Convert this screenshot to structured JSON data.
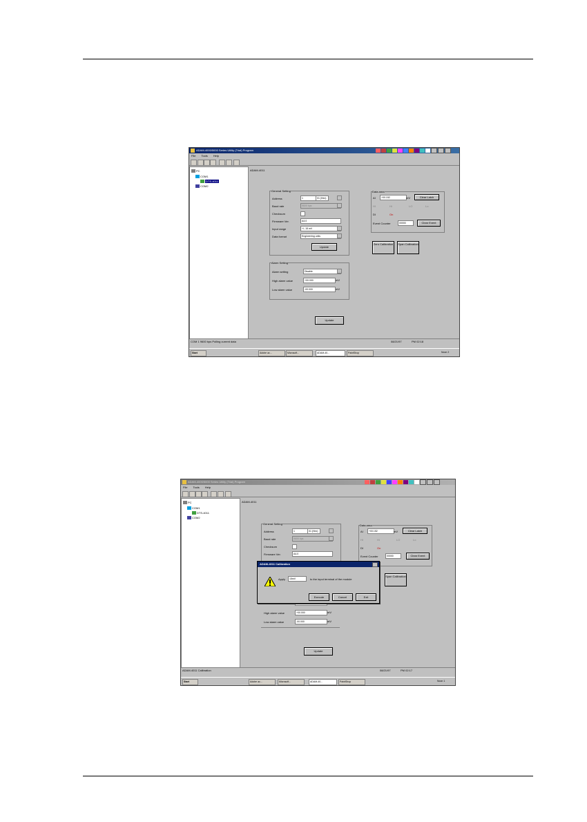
{
  "app_title": "ADAM-4000/5000 Series Utility (Trial) Program",
  "menu": [
    "File",
    "Tools",
    "Help"
  ],
  "tree": {
    "root": "PC",
    "com": "COM1",
    "module": "COM1",
    "device": "DTS-4011",
    "com2": "COM2"
  },
  "module_title": "ADAM-4011",
  "general": {
    "title": "General Setting",
    "address_label": "Address",
    "address_value": "1",
    "address_hex": "01 (Hex)",
    "baud_label": "Baud rate",
    "baud_value": "9600 bps",
    "checksum_label": "Checksum",
    "firmware_label": "Firmware Ver.",
    "firmware_value": "A4.0",
    "input_label": "Input range",
    "input_value": "+/- 15 mV",
    "format_label": "Data format",
    "format_value": "Engineering units",
    "update_label": "Update"
  },
  "data_area": {
    "title": "Data area",
    "ai_label": "AI",
    "ai_value": "+00.152",
    "ai_unit": "mV",
    "clear_latch": "Clear Latch",
    "hi_label": "HI",
    "hi_value": "Hi",
    "lo_label": "LO",
    "lo_value": "Lo",
    "di_label": "DI",
    "di_value": "On",
    "event_label": "Event Counter",
    "event_value": "00000",
    "clear_event": "Clear Event",
    "zero_cal": "Zero Calibration",
    "span_cal": "Span Calibration"
  },
  "alarm": {
    "title": "Alarm Setting",
    "mode_label": "Alarm setting",
    "mode_value": "Disable",
    "high_label": "High alarm value",
    "high_value": "+00.000",
    "high_unit": "mV",
    "low_label": "Low alarm value",
    "low_value": "-00.000",
    "low_unit": "mV",
    "update_label": "Update"
  },
  "status1": {
    "text": "COM 1  9600 bps  Polling current data",
    "date": "08/21/97",
    "time": "PM 02:18"
  },
  "status2": {
    "text": "ADAM-4011  Calibration",
    "date": "08/21/97",
    "time": "PM 02:17"
  },
  "taskbar": {
    "start": "Start",
    "tasks1": [
      "Adobe ac...",
      "Microsoft...",
      "ADAM-40...",
      "PaintShop"
    ],
    "tasks2": [
      "Adobe ac...",
      "Microsoft...",
      "ADAM-40...",
      "PaintShop"
    ],
    "clock1": "Noon 2",
    "clock2": "Noon 1"
  },
  "dialog": {
    "title": "ADAM-4011 Calibration",
    "label": "Apply",
    "value": "15mV",
    "message": "to the input terminal of the module",
    "execute": "Execute",
    "cancel": "Cancel",
    "exit": "Exit"
  },
  "colors": {
    "title_active": "#0a246a",
    "window_bg": "#c0c0c0",
    "highlight": "#000080",
    "on_red": "#c00000"
  }
}
